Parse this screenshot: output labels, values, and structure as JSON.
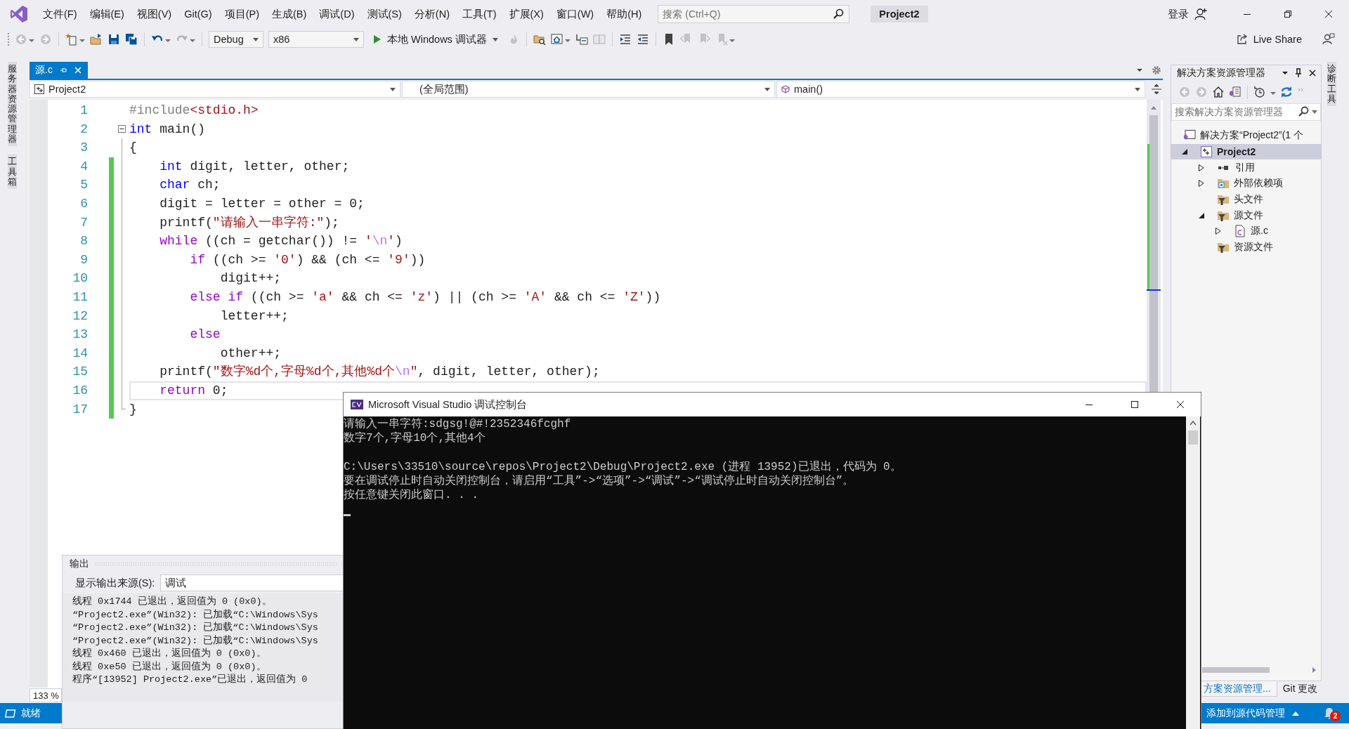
{
  "menu": [
    "文件(F)",
    "编辑(E)",
    "视图(V)",
    "Git(G)",
    "项目(P)",
    "生成(B)",
    "调试(D)",
    "测试(S)",
    "分析(N)",
    "工具(T)",
    "扩展(X)",
    "窗口(W)",
    "帮助(H)"
  ],
  "search": {
    "placeholder": "搜索 (Ctrl+Q)"
  },
  "solution_title": "Project2",
  "account": "登录",
  "toolbar": {
    "configuration": "Debug",
    "platform": "x86",
    "debugger": "本地 Windows 调试器",
    "live_share": "Live Share"
  },
  "left_strip": [
    "服务器资源管理器",
    "工具箱"
  ],
  "document_tabs": [
    {
      "label": "源.c",
      "selected": true
    }
  ],
  "nav_bar": {
    "project": "Project2",
    "scope": "(全局范围)",
    "member": "main()"
  },
  "editor": {
    "zoom": "133 %",
    "lines": [
      {
        "number": "1",
        "changed": false,
        "current": false,
        "fold_start": false,
        "tokens": [
          {
            "kind": "preproc",
            "text": "#include"
          },
          {
            "kind": "string",
            "text": "<stdio.h>"
          }
        ]
      },
      {
        "number": "2",
        "changed": false,
        "current": false,
        "fold_start": true,
        "tokens": [
          {
            "kind": "keyword",
            "text": "int"
          },
          {
            "kind": "plain",
            "text": " main()"
          }
        ]
      },
      {
        "number": "3",
        "changed": false,
        "current": false,
        "fold_start": false,
        "tokens": [
          {
            "kind": "plain",
            "text": "{"
          }
        ]
      },
      {
        "number": "4",
        "changed": true,
        "current": false,
        "fold_start": false,
        "tokens": [
          {
            "kind": "keyword",
            "text": "    int"
          },
          {
            "kind": "plain",
            "text": " digit, letter, other;"
          }
        ]
      },
      {
        "number": "5",
        "changed": true,
        "current": false,
        "fold_start": false,
        "tokens": [
          {
            "kind": "keyword",
            "text": "    char"
          },
          {
            "kind": "plain",
            "text": " ch;"
          }
        ]
      },
      {
        "number": "6",
        "changed": true,
        "current": false,
        "fold_start": false,
        "tokens": [
          {
            "kind": "plain",
            "text": "    digit = letter = other = 0;"
          }
        ]
      },
      {
        "number": "7",
        "changed": true,
        "current": false,
        "fold_start": false,
        "tokens": [
          {
            "kind": "plain",
            "text": "    printf("
          },
          {
            "kind": "string",
            "text": "\"请输入一串字符:\""
          },
          {
            "kind": "plain",
            "text": ");"
          }
        ]
      },
      {
        "number": "8",
        "changed": true,
        "current": false,
        "fold_start": false,
        "tokens": [
          {
            "kind": "control",
            "text": "    while"
          },
          {
            "kind": "plain",
            "text": " ((ch = getchar()) != "
          },
          {
            "kind": "string",
            "text": "'"
          },
          {
            "kind": "escape",
            "text": "\\n"
          },
          {
            "kind": "string",
            "text": "'"
          },
          {
            "kind": "plain",
            "text": ")"
          }
        ]
      },
      {
        "number": "9",
        "changed": true,
        "current": false,
        "fold_start": false,
        "tokens": [
          {
            "kind": "control",
            "text": "        if"
          },
          {
            "kind": "plain",
            "text": " ((ch >= "
          },
          {
            "kind": "string",
            "text": "'0'"
          },
          {
            "kind": "plain",
            "text": ") && (ch <= "
          },
          {
            "kind": "string",
            "text": "'9'"
          },
          {
            "kind": "plain",
            "text": "))"
          }
        ]
      },
      {
        "number": "10",
        "changed": true,
        "current": false,
        "fold_start": false,
        "tokens": [
          {
            "kind": "plain",
            "text": "            digit++;"
          }
        ]
      },
      {
        "number": "11",
        "changed": true,
        "current": false,
        "fold_start": false,
        "tokens": [
          {
            "kind": "control",
            "text": "        else if"
          },
          {
            "kind": "plain",
            "text": " ((ch >= "
          },
          {
            "kind": "string",
            "text": "'a'"
          },
          {
            "kind": "plain",
            "text": " && ch <= "
          },
          {
            "kind": "string",
            "text": "'z'"
          },
          {
            "kind": "plain",
            "text": ") || (ch >= "
          },
          {
            "kind": "string",
            "text": "'A'"
          },
          {
            "kind": "plain",
            "text": " && ch <= "
          },
          {
            "kind": "string",
            "text": "'Z'"
          },
          {
            "kind": "plain",
            "text": "))"
          }
        ]
      },
      {
        "number": "12",
        "changed": true,
        "current": false,
        "fold_start": false,
        "tokens": [
          {
            "kind": "plain",
            "text": "            letter++;"
          }
        ]
      },
      {
        "number": "13",
        "changed": true,
        "current": false,
        "fold_start": false,
        "tokens": [
          {
            "kind": "control",
            "text": "        else"
          }
        ]
      },
      {
        "number": "14",
        "changed": true,
        "current": false,
        "fold_start": false,
        "tokens": [
          {
            "kind": "plain",
            "text": "            other++;"
          }
        ]
      },
      {
        "number": "15",
        "changed": true,
        "current": false,
        "fold_start": false,
        "tokens": [
          {
            "kind": "plain",
            "text": "    printf("
          },
          {
            "kind": "string",
            "text": "\"数字%d个,字母%d个,其他%d个"
          },
          {
            "kind": "escape",
            "text": "\\n"
          },
          {
            "kind": "string",
            "text": "\""
          },
          {
            "kind": "plain",
            "text": ", digit, letter, other);"
          }
        ]
      },
      {
        "number": "16",
        "changed": true,
        "current": true,
        "fold_start": false,
        "tokens": [
          {
            "kind": "control",
            "text": "    return"
          },
          {
            "kind": "plain",
            "text": " 0;"
          }
        ]
      },
      {
        "number": "17",
        "changed": true,
        "current": false,
        "fold_start": false,
        "tokens": [
          {
            "kind": "plain",
            "text": "}"
          }
        ]
      }
    ]
  },
  "output": {
    "title": "输出",
    "source_label": "显示输出来源(S):",
    "source": "调试",
    "lines": [
      "线程 0x1744 已退出，返回值为 0 (0x0)。",
      "“Project2.exe”(Win32): 已加载“C:\\Windows\\Sys",
      "“Project2.exe”(Win32): 已加载“C:\\Windows\\Sys",
      "“Project2.exe”(Win32): 已加载“C:\\Windows\\Sys",
      "线程 0x460 已退出，返回值为 0 (0x0)。",
      "线程 0xe50 已退出，返回值为 0 (0x0)。",
      "程序“[13952] Project2.exe”已退出，返回值为 0"
    ]
  },
  "console": {
    "title": "Microsoft Visual Studio 调试控制台",
    "cursor": true,
    "lines": [
      {
        "kind": "text",
        "text": "请输入一串字符:sdgsg!@#!2352346fcghf"
      },
      {
        "kind": "text",
        "text": "数字7个,字母10个,其他4个"
      },
      {
        "kind": "blank"
      },
      {
        "kind": "text",
        "text": "C:\\Users\\33510\\source\\repos\\Project2\\Debug\\Project2.exe (进程 13952)已退出，代码为 0。"
      },
      {
        "kind": "text",
        "text": "要在调试停止时自动关闭控制台，请启用“工具”->“选项”->“调试”->“调试停止时自动关闭控制台”。"
      },
      {
        "kind": "text",
        "text": "按任意键关闭此窗口. . ."
      }
    ]
  },
  "solution_explorer": {
    "title": "解决方案资源管理器",
    "search_placeholder": "搜索解决方案资源管理器",
    "tree": [
      {
        "label": "解决方案“Project2”(1 个",
        "kind": "solution",
        "expandable": false,
        "selected": false,
        "startup": false,
        "children": [
          {
            "label": "Project2",
            "kind": "project",
            "expandable": true,
            "expanded": true,
            "selected": true,
            "startup": true,
            "children": [
              {
                "label": "引用",
                "kind": "references",
                "expandable": true,
                "expanded": false,
                "selected": false,
                "startup": false
              },
              {
                "label": "外部依赖项",
                "kind": "dependencies",
                "expandable": true,
                "expanded": false,
                "selected": false,
                "startup": false
              },
              {
                "label": "头文件",
                "kind": "filter",
                "expandable": false,
                "selected": false,
                "startup": false
              },
              {
                "label": "源文件",
                "kind": "filter",
                "expandable": true,
                "expanded": true,
                "selected": false,
                "startup": false,
                "children": [
                  {
                    "label": "源.c",
                    "kind": "file",
                    "expandable": true,
                    "expanded": false,
                    "selected": false,
                    "startup": false
                  }
                ]
              },
              {
                "label": "资源文件",
                "kind": "filter",
                "expandable": false,
                "selected": false,
                "startup": false
              }
            ]
          }
        ]
      }
    ],
    "tabs": [
      {
        "label": "方案资源管理...",
        "selected": true
      },
      {
        "label": "Git 更改",
        "selected": false
      }
    ]
  },
  "right_strip": [
    "诊断工具"
  ],
  "status_bar": {
    "status": "就绪",
    "source_control": "添加到源代码管理",
    "notifications": "2"
  }
}
